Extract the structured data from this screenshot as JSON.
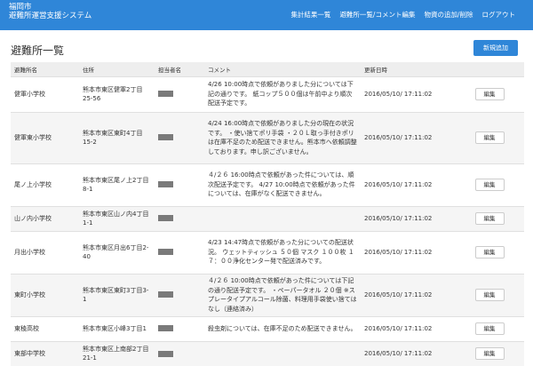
{
  "app": {
    "line1": "福岡市",
    "line2": "避難所運営支援システム"
  },
  "nav": [
    "集計結果一覧",
    "避難所一覧/コメント編集",
    "物資の追加/削除",
    "ログアウト"
  ],
  "page": {
    "title": "避難所一覧",
    "new_button": "新規追加"
  },
  "table": {
    "headers": [
      "避難所名",
      "住所",
      "担当者名",
      "コメント",
      "更新日時",
      ""
    ],
    "edit_label": "編集",
    "rows": [
      {
        "name": "健軍小学校",
        "address": "熊本市東区健軍2丁目25-56",
        "comment": "4/26 10:00時点で依頼がありました分については下記の通りです。 紙コップ５００個は午前中より順次配送予定です。",
        "updated": "2016/05/10/ 17:11:02"
      },
      {
        "name": "健軍東小学校",
        "address": "熊本市東区東町4丁目15-2",
        "comment": "4/24 16:00時点で依頼がありました分の現在の状況です。 ・使い捨てポリ手袋 ・２０Ｌ取っ手付きポリ は在庫不足のため配送できません。熊本市へ依頼調整しております。申し訳ございません。",
        "updated": "2016/05/10/ 17:11:02"
      },
      {
        "name": "尾ノ上小学校",
        "address": "熊本市東区尾ノ上2丁目8-1",
        "comment": "４/２６ 16:00時点で依頼があった件については、順次配送予定です。 4/27 10:00時点で依頼があった件については、在庫がなく配送できません。",
        "updated": "2016/05/10/ 17:11:02"
      },
      {
        "name": "山ノ内小学校",
        "address": "熊本市東区山ノ内4丁目1-1",
        "comment": "",
        "updated": "2016/05/10/ 17:11:02"
      },
      {
        "name": "月出小学校",
        "address": "熊本市東区月出6丁目2-40",
        "comment": "4/23 14:47時点で依頼があった分についての配送状況。 ウェットティッシュ ５０個 マスク １００枚 １７：００浄化センター発で配送済みです。",
        "updated": "2016/05/10/ 17:11:02"
      },
      {
        "name": "東町小学校",
        "address": "熊本市東区東町3丁目3-1",
        "comment": "４/２６ 10:00時点で依頼があった件については下記の通り配送予定です。 ・ペーパータオル ２０個 ※スプレータイプアルコール除菌、料理用手袋使い捨てはなし（連絡済み）",
        "updated": "2016/05/10/ 17:11:02"
      },
      {
        "name": "東稜高校",
        "address": "熊本市東区小峰3丁目1",
        "comment": "殺虫剤については、在庫不足のため配送できません。",
        "updated": "2016/05/10/ 17:11:02"
      },
      {
        "name": "東部中学校",
        "address": "熊本市東区上南部2丁目21-1",
        "comment": "",
        "updated": "2016/05/10/ 17:11:02"
      }
    ]
  }
}
